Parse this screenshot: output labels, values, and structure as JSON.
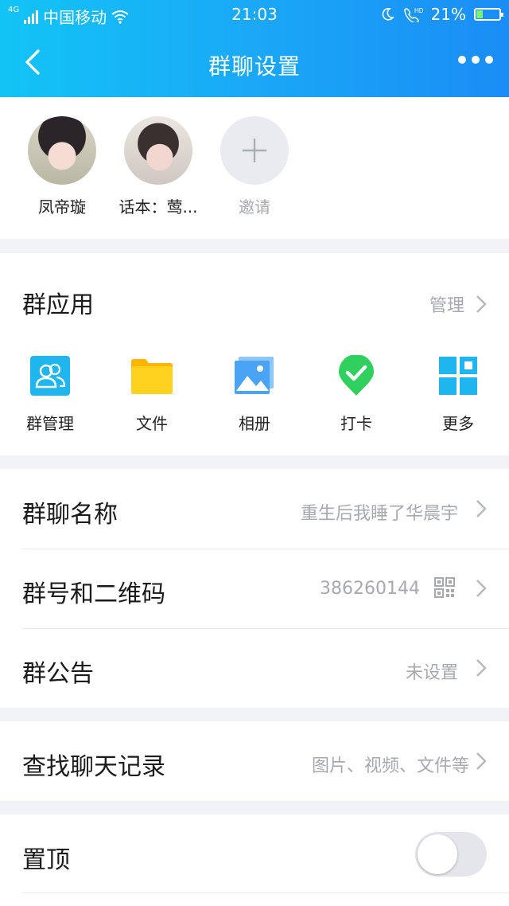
{
  "status_bar": {
    "carrier": "中国移动",
    "network": "4G",
    "time": "21:03",
    "battery": "21%"
  },
  "nav": {
    "title": "群聊设置"
  },
  "members": [
    {
      "name": "凤帝璇"
    },
    {
      "name": "话本：莺..."
    },
    {
      "name": "邀请"
    }
  ],
  "apps": {
    "title": "群应用",
    "manage_label": "管理",
    "items": [
      {
        "label": "群管理",
        "icon": "group-manage-icon",
        "color": "#1fb6f0"
      },
      {
        "label": "文件",
        "icon": "folder-icon",
        "color": "#ffc400"
      },
      {
        "label": "相册",
        "icon": "album-icon",
        "color": "#4aa4f5"
      },
      {
        "label": "打卡",
        "icon": "checkin-icon",
        "color": "#2fd05d"
      },
      {
        "label": "更多",
        "icon": "more-grid-icon",
        "color": "#1fb6f0"
      }
    ]
  },
  "info": {
    "name_label": "群聊名称",
    "name_value": "重生后我睡了华晨宇",
    "number_label": "群号和二维码",
    "number_value": "386260144",
    "notice_label": "群公告",
    "notice_value": "未设置"
  },
  "search": {
    "label": "查找聊天记录",
    "value": "图片、视频、文件等"
  },
  "pin": {
    "label": "置顶",
    "enabled": false
  }
}
